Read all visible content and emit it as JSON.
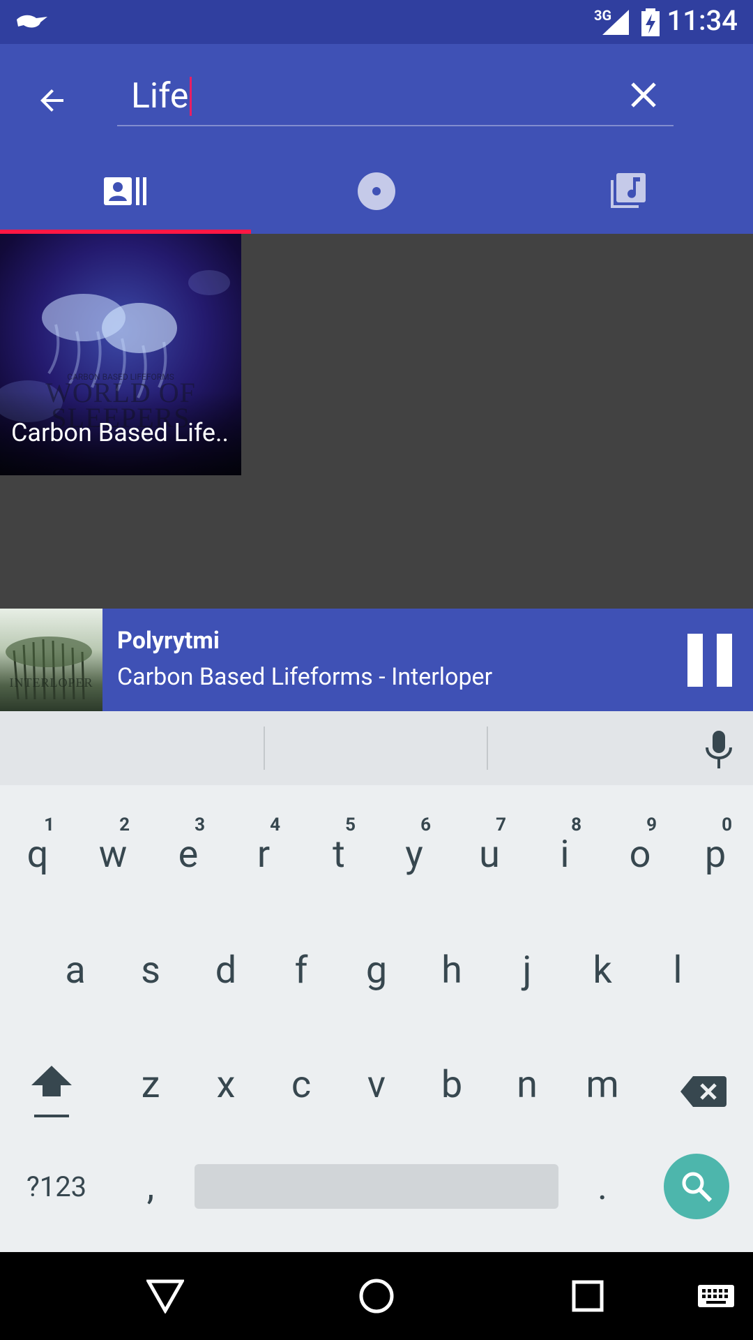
{
  "status_bar": {
    "network": "3G",
    "time": "11:34"
  },
  "search": {
    "query": "Life"
  },
  "tabs": [
    {
      "icon": "artist-icon",
      "active": true
    },
    {
      "icon": "album-icon",
      "active": false
    },
    {
      "icon": "song-icon",
      "active": false
    }
  ],
  "results": {
    "albums": [
      {
        "label": "Carbon Based Life..",
        "art_small_text": "CARBON BASED LIFEFORMS",
        "art_title": "WORLD OF SLEEPERS"
      }
    ]
  },
  "now_playing": {
    "title": "Polyrytmi",
    "subtitle": "Carbon Based Lifeforms - Interloper",
    "art_text": "INTERLOPER",
    "state": "playing"
  },
  "keyboard": {
    "row1": [
      {
        "key": "q",
        "hint": "1"
      },
      {
        "key": "w",
        "hint": "2"
      },
      {
        "key": "e",
        "hint": "3"
      },
      {
        "key": "r",
        "hint": "4"
      },
      {
        "key": "t",
        "hint": "5"
      },
      {
        "key": "y",
        "hint": "6"
      },
      {
        "key": "u",
        "hint": "7"
      },
      {
        "key": "i",
        "hint": "8"
      },
      {
        "key": "o",
        "hint": "9"
      },
      {
        "key": "p",
        "hint": "0"
      }
    ],
    "row2": [
      "a",
      "s",
      "d",
      "f",
      "g",
      "h",
      "j",
      "k",
      "l"
    ],
    "row3": [
      "z",
      "x",
      "c",
      "v",
      "b",
      "n",
      "m"
    ],
    "symbols_label": "?123",
    "comma": ",",
    "period": "."
  }
}
